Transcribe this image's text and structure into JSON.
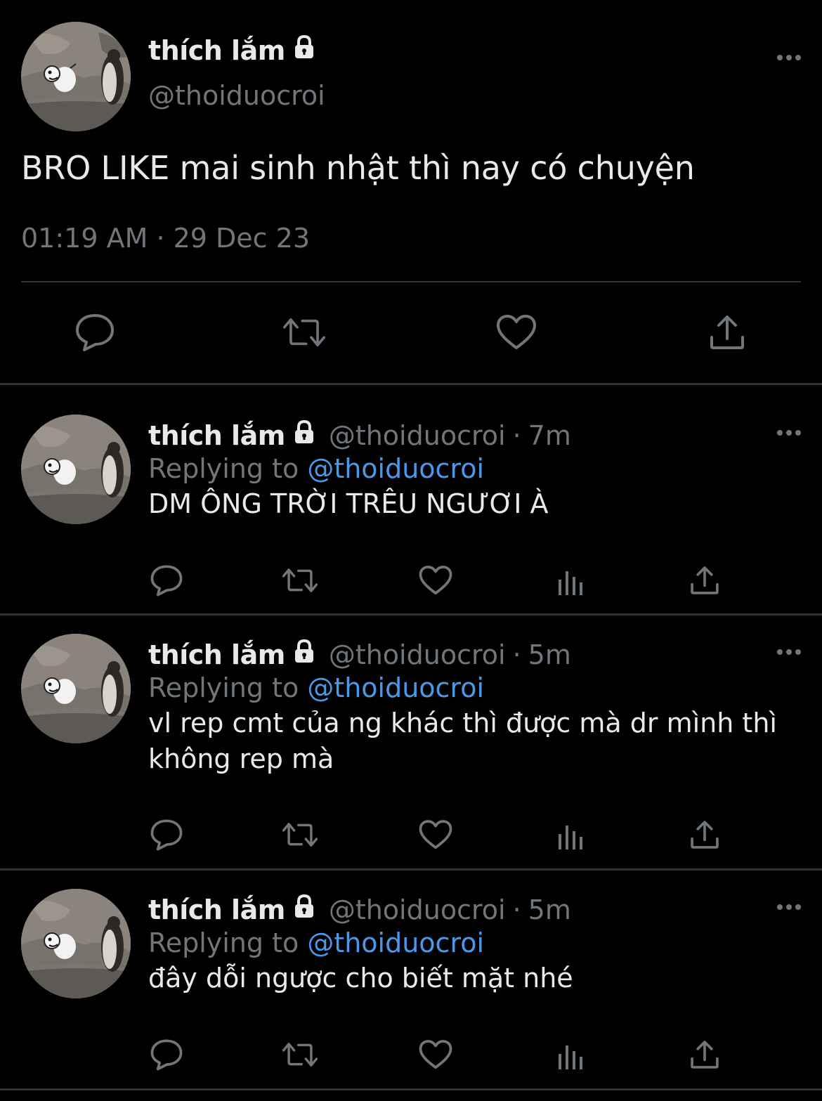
{
  "main_tweet": {
    "display_name": "thích lắm",
    "handle": "@thoiduocroi",
    "text": "BRO LIKE mai sinh nhật thì nay có chuyện",
    "timestamp": "01:19 AM · 29 Dec 23",
    "icons": [
      "lock-icon",
      "more-icon",
      "reply-icon",
      "retweet-icon",
      "like-icon",
      "share-icon"
    ]
  },
  "replies": [
    {
      "display_name": "thích lắm",
      "handle": "@thoiduocroi",
      "separator": "·",
      "time": "7m",
      "replying_prefix": "Replying to ",
      "replying_to": "@thoiduocroi",
      "text": "DM ÔNG TRỜI TRÊU NGƯƠI À"
    },
    {
      "display_name": "thích lắm",
      "handle": "@thoiduocroi",
      "separator": "·",
      "time": "5m",
      "replying_prefix": "Replying to ",
      "replying_to": "@thoiduocroi",
      "text": "vl rep cmt của ng khác thì được mà dr mình thì không rep mà"
    },
    {
      "display_name": "thích lắm",
      "handle": "@thoiduocroi",
      "separator": "·",
      "time": "5m",
      "replying_prefix": "Replying to ",
      "replying_to": "@thoiduocroi",
      "text": "đây dỗi ngược cho biết mặt nhé"
    }
  ],
  "colors": {
    "background": "#000000",
    "text": "#e7e9ea",
    "secondary": "#71767b",
    "link": "#4a99e9",
    "divider": "#2f3336"
  }
}
